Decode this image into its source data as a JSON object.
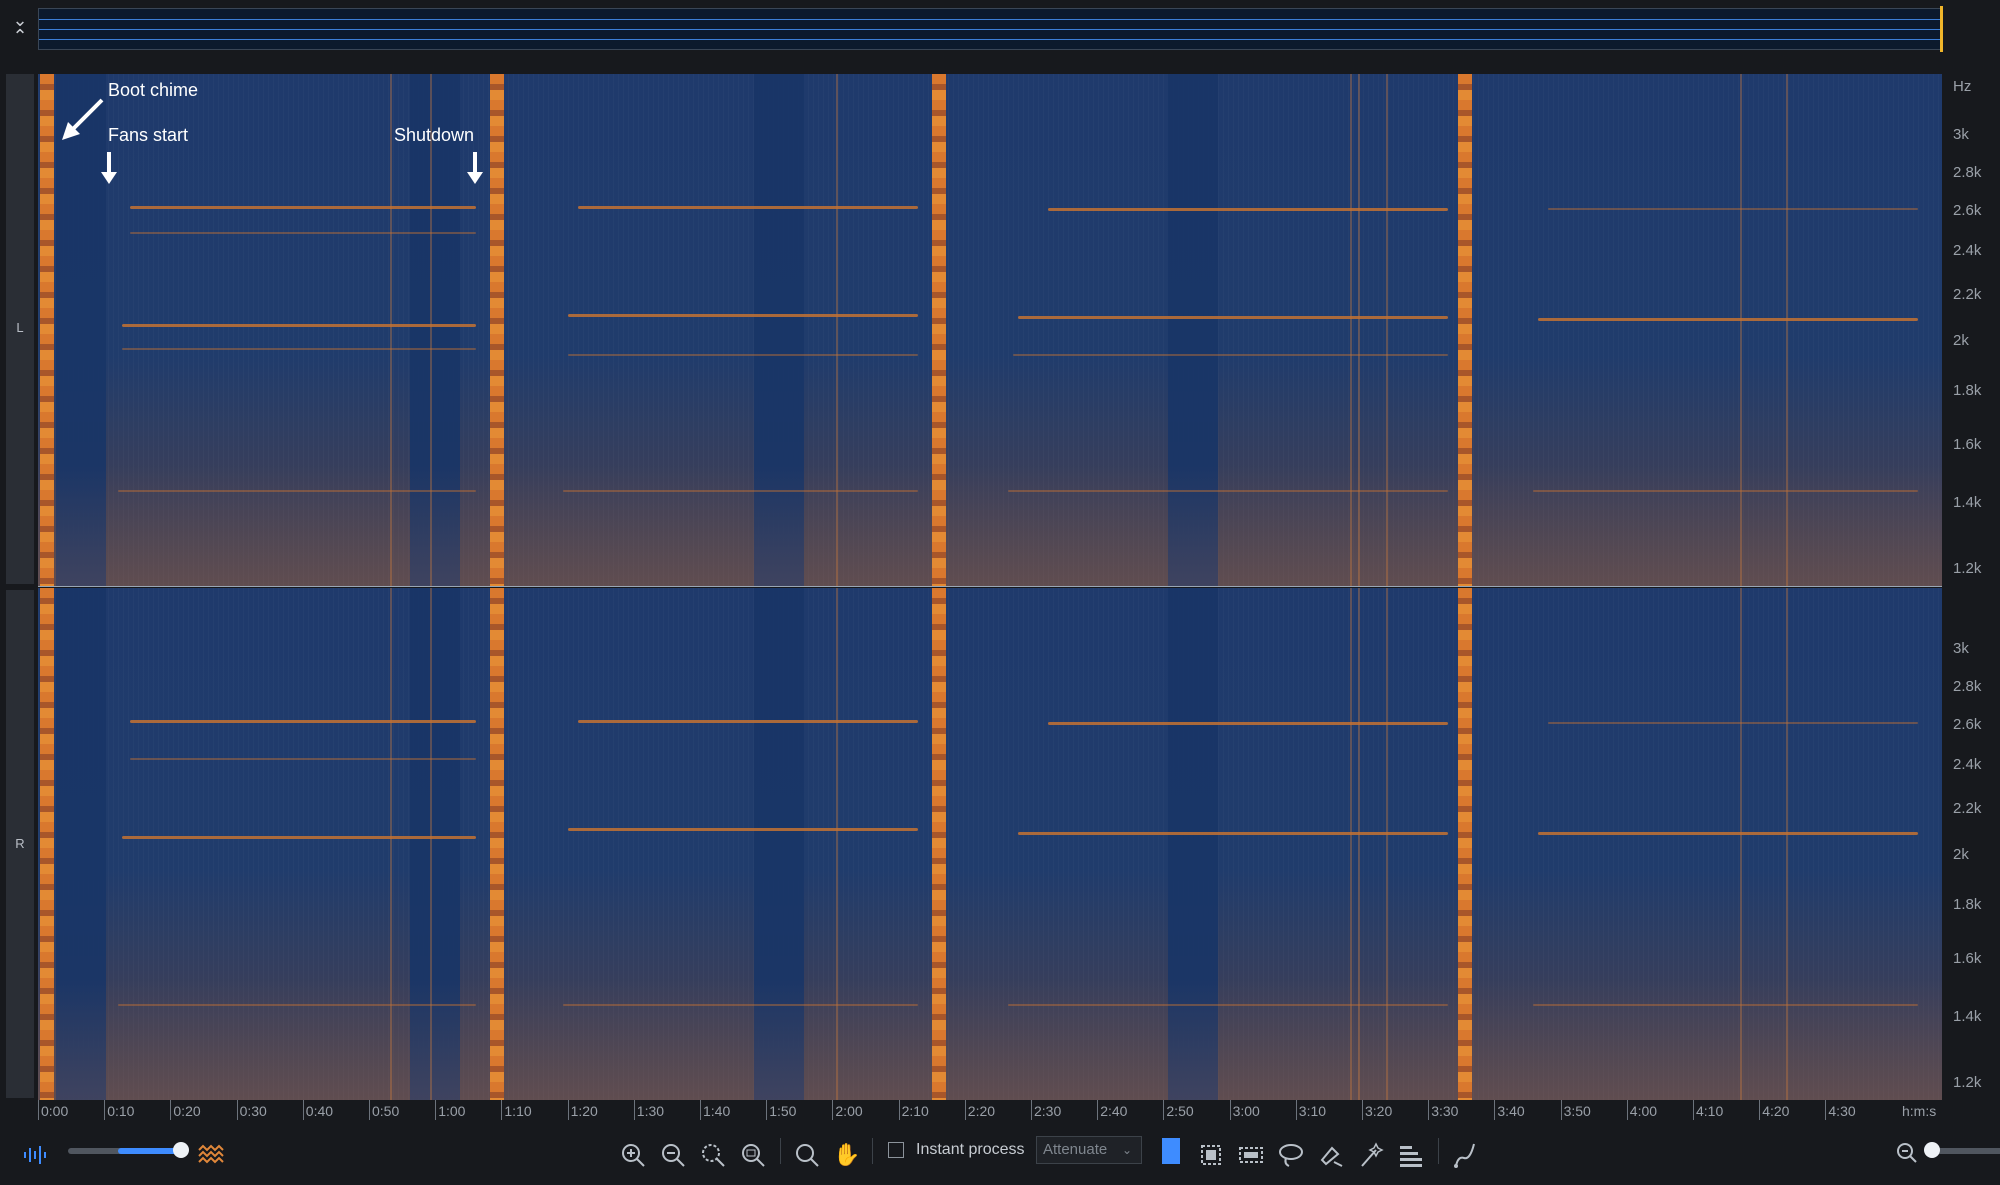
{
  "channels": {
    "left": "L",
    "right": "R"
  },
  "freq_axis": {
    "unit": "Hz",
    "ticks": [
      "3k",
      "2.8k",
      "2.6k",
      "2.4k",
      "2.2k",
      "2k",
      "1.8k",
      "1.6k",
      "1.4k",
      "1.2k"
    ]
  },
  "time_axis": {
    "unit": "h:m:s",
    "ticks": [
      "0:00",
      "0:10",
      "0:20",
      "0:30",
      "0:40",
      "0:50",
      "1:00",
      "1:10",
      "1:20",
      "1:30",
      "1:40",
      "1:50",
      "2:00",
      "2:10",
      "2:20",
      "2:30",
      "2:40",
      "2:50",
      "3:00",
      "3:10",
      "3:20",
      "3:30",
      "3:40",
      "3:50",
      "4:00",
      "4:10",
      "4:20",
      "4:30"
    ]
  },
  "annotations": {
    "boot_chime": "Boot chime",
    "fans_start": "Fans start",
    "shutdown": "Shutdown"
  },
  "toolbar": {
    "instant_process_label": "Instant process",
    "instant_process_checked": false,
    "mode_value": "Attenuate",
    "icons": [
      "waveform-icon",
      "spectrogram-icon",
      "zoom-in-icon",
      "zoom-out-icon",
      "zoom-selection-icon",
      "zoom-fit-icon",
      "magnify-icon",
      "hand-icon",
      "time-selection-icon",
      "frequency-selection-icon",
      "time-frequency-selection-icon",
      "lasso-icon",
      "brush-icon",
      "magic-wand-icon",
      "harmonics-icon",
      "pencil-curve-icon",
      "zoom-out-vertical-icon"
    ]
  },
  "colors": {
    "background": "#17191d",
    "spectrogram_base": "#1f3a6c",
    "spectrogram_energy": "#d9782e",
    "accent": "#3e8cff",
    "playhead": "#f0b52a"
  }
}
